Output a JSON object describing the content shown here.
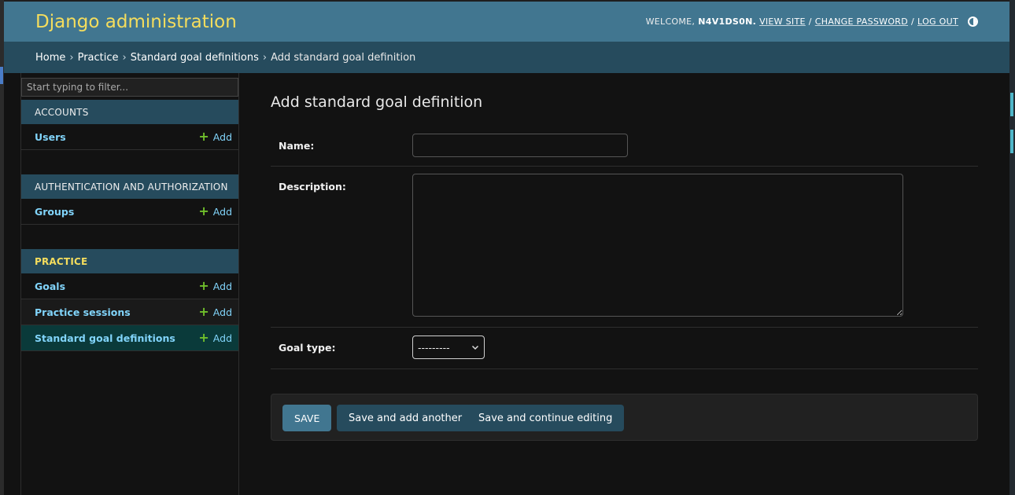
{
  "header": {
    "brand": "Django administration",
    "welcome": "WELCOME,",
    "username": "N4V1DS0N.",
    "view_site": "VIEW SITE",
    "change_password": "CHANGE PASSWORD",
    "log_out": "LOG OUT",
    "separator": "/"
  },
  "breadcrumbs": {
    "home": "Home",
    "app": "Practice",
    "model": "Standard goal definitions",
    "current": "Add standard goal definition",
    "separator": "›"
  },
  "sidebar": {
    "filter_placeholder": "Start typing to filter...",
    "add_label": "Add",
    "modules": [
      {
        "name": "ACCOUNTS",
        "models": [
          "Users"
        ]
      },
      {
        "name": "AUTHENTICATION AND AUTHORIZATION",
        "models": [
          "Groups"
        ]
      },
      {
        "name": "PRACTICE",
        "models": [
          "Goals",
          "Practice sessions",
          "Standard goal definitions"
        ]
      }
    ]
  },
  "content": {
    "title": "Add standard goal definition",
    "fields": {
      "name_label": "Name:",
      "name_value": "",
      "description_label": "Description:",
      "description_value": "",
      "goal_type_label": "Goal type:",
      "goal_type_selected": "---------"
    },
    "buttons": {
      "save": "SAVE",
      "save_add_another": "Save and add another",
      "save_continue": "Save and continue editing"
    }
  },
  "colors": {
    "header_bg": "#417690",
    "brand": "#f5dd5d",
    "breadcrumb_bg": "#264b5d",
    "link": "#81d4fa",
    "add_plus": "#70bf2b",
    "body_bg": "#121212"
  }
}
